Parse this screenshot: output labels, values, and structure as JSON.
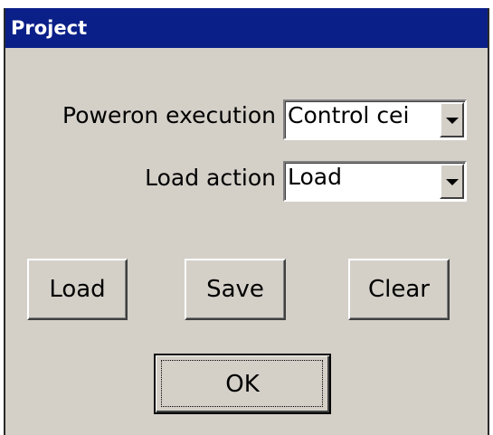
{
  "dialog": {
    "title": "Project",
    "poweron": {
      "label": "Poweron execution",
      "value": "Control cei"
    },
    "load_action": {
      "label": "Load action",
      "value": "Load"
    },
    "buttons": {
      "load": "Load",
      "save": "Save",
      "clear": "Clear",
      "ok": "OK"
    },
    "icons": {
      "dropdown": "chevron-down-icon"
    }
  }
}
